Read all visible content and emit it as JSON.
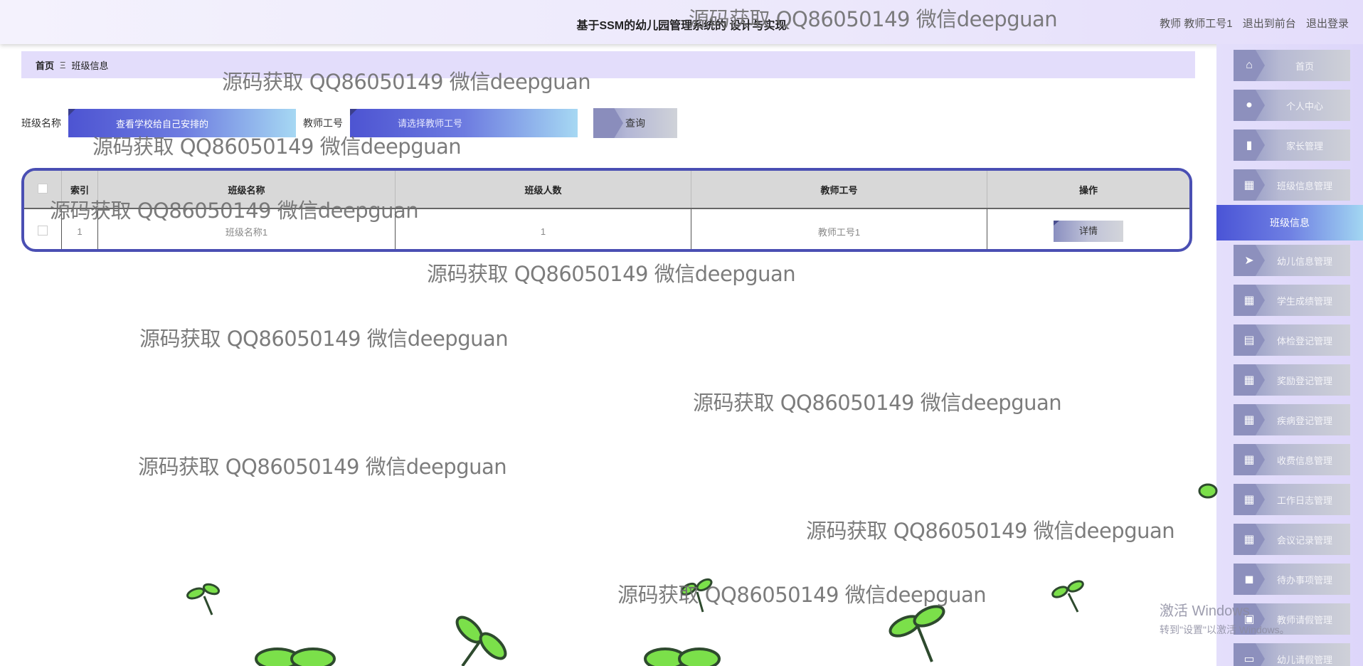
{
  "header": {
    "title": "基于SSM的幼儿园管理系统的 设计与实现",
    "user_label": "教师 教师工号1",
    "back_front": "退出到前台",
    "logout": "退出登录"
  },
  "breadcrumb": {
    "home": "首页",
    "separator": "Ξ",
    "current": "班级信息"
  },
  "search": {
    "class_name_label": "班级名称",
    "class_name_value": "查看学校给自己安排的",
    "teacher_id_label": "教师工号",
    "teacher_id_placeholder": "请选择教师工号",
    "query_button": "查询"
  },
  "table": {
    "headers": [
      "索引",
      "班级名称",
      "班级人数",
      "教师工号",
      "操作"
    ],
    "rows": [
      {
        "index": "1",
        "class_name": "班级名称1",
        "count": "1",
        "teacher_id": "教师工号1",
        "action": "详情"
      }
    ]
  },
  "sidebar": {
    "items": [
      {
        "label": "首页",
        "icon": "home-icon"
      },
      {
        "label": "个人中心",
        "icon": "user-icon"
      },
      {
        "label": "家长管理",
        "icon": "bar-chart-icon"
      },
      {
        "label": "班级信息管理",
        "icon": "grid-icon"
      },
      {
        "label": "班级信息",
        "icon": "",
        "active": true
      },
      {
        "label": "幼儿信息管理",
        "icon": "paper-plane-icon"
      },
      {
        "label": "学生成绩管理",
        "icon": "grid-icon"
      },
      {
        "label": "体检登记管理",
        "icon": "clipboard-icon"
      },
      {
        "label": "奖励登记管理",
        "icon": "grid-icon"
      },
      {
        "label": "疾病登记管理",
        "icon": "grid-icon"
      },
      {
        "label": "收费信息管理",
        "icon": "grid-icon"
      },
      {
        "label": "工作日志管理",
        "icon": "grid-icon"
      },
      {
        "label": "会议记录管理",
        "icon": "grid-icon"
      },
      {
        "label": "待办事项管理",
        "icon": "briefcase-icon"
      },
      {
        "label": "教师请假管理",
        "icon": "document-icon"
      },
      {
        "label": "幼儿请假管理",
        "icon": "monitor-icon"
      }
    ]
  },
  "watermark": "源码获取 QQ86050149 微信deepguan",
  "windows_activation": {
    "line1": "激活 Windows",
    "line2": "转到\"设置\"以激活 Windows。"
  },
  "colors": {
    "accent": "#4a4fb3",
    "sidebar_bg": "#e1dcfb",
    "header_bg": "#efecfc"
  }
}
